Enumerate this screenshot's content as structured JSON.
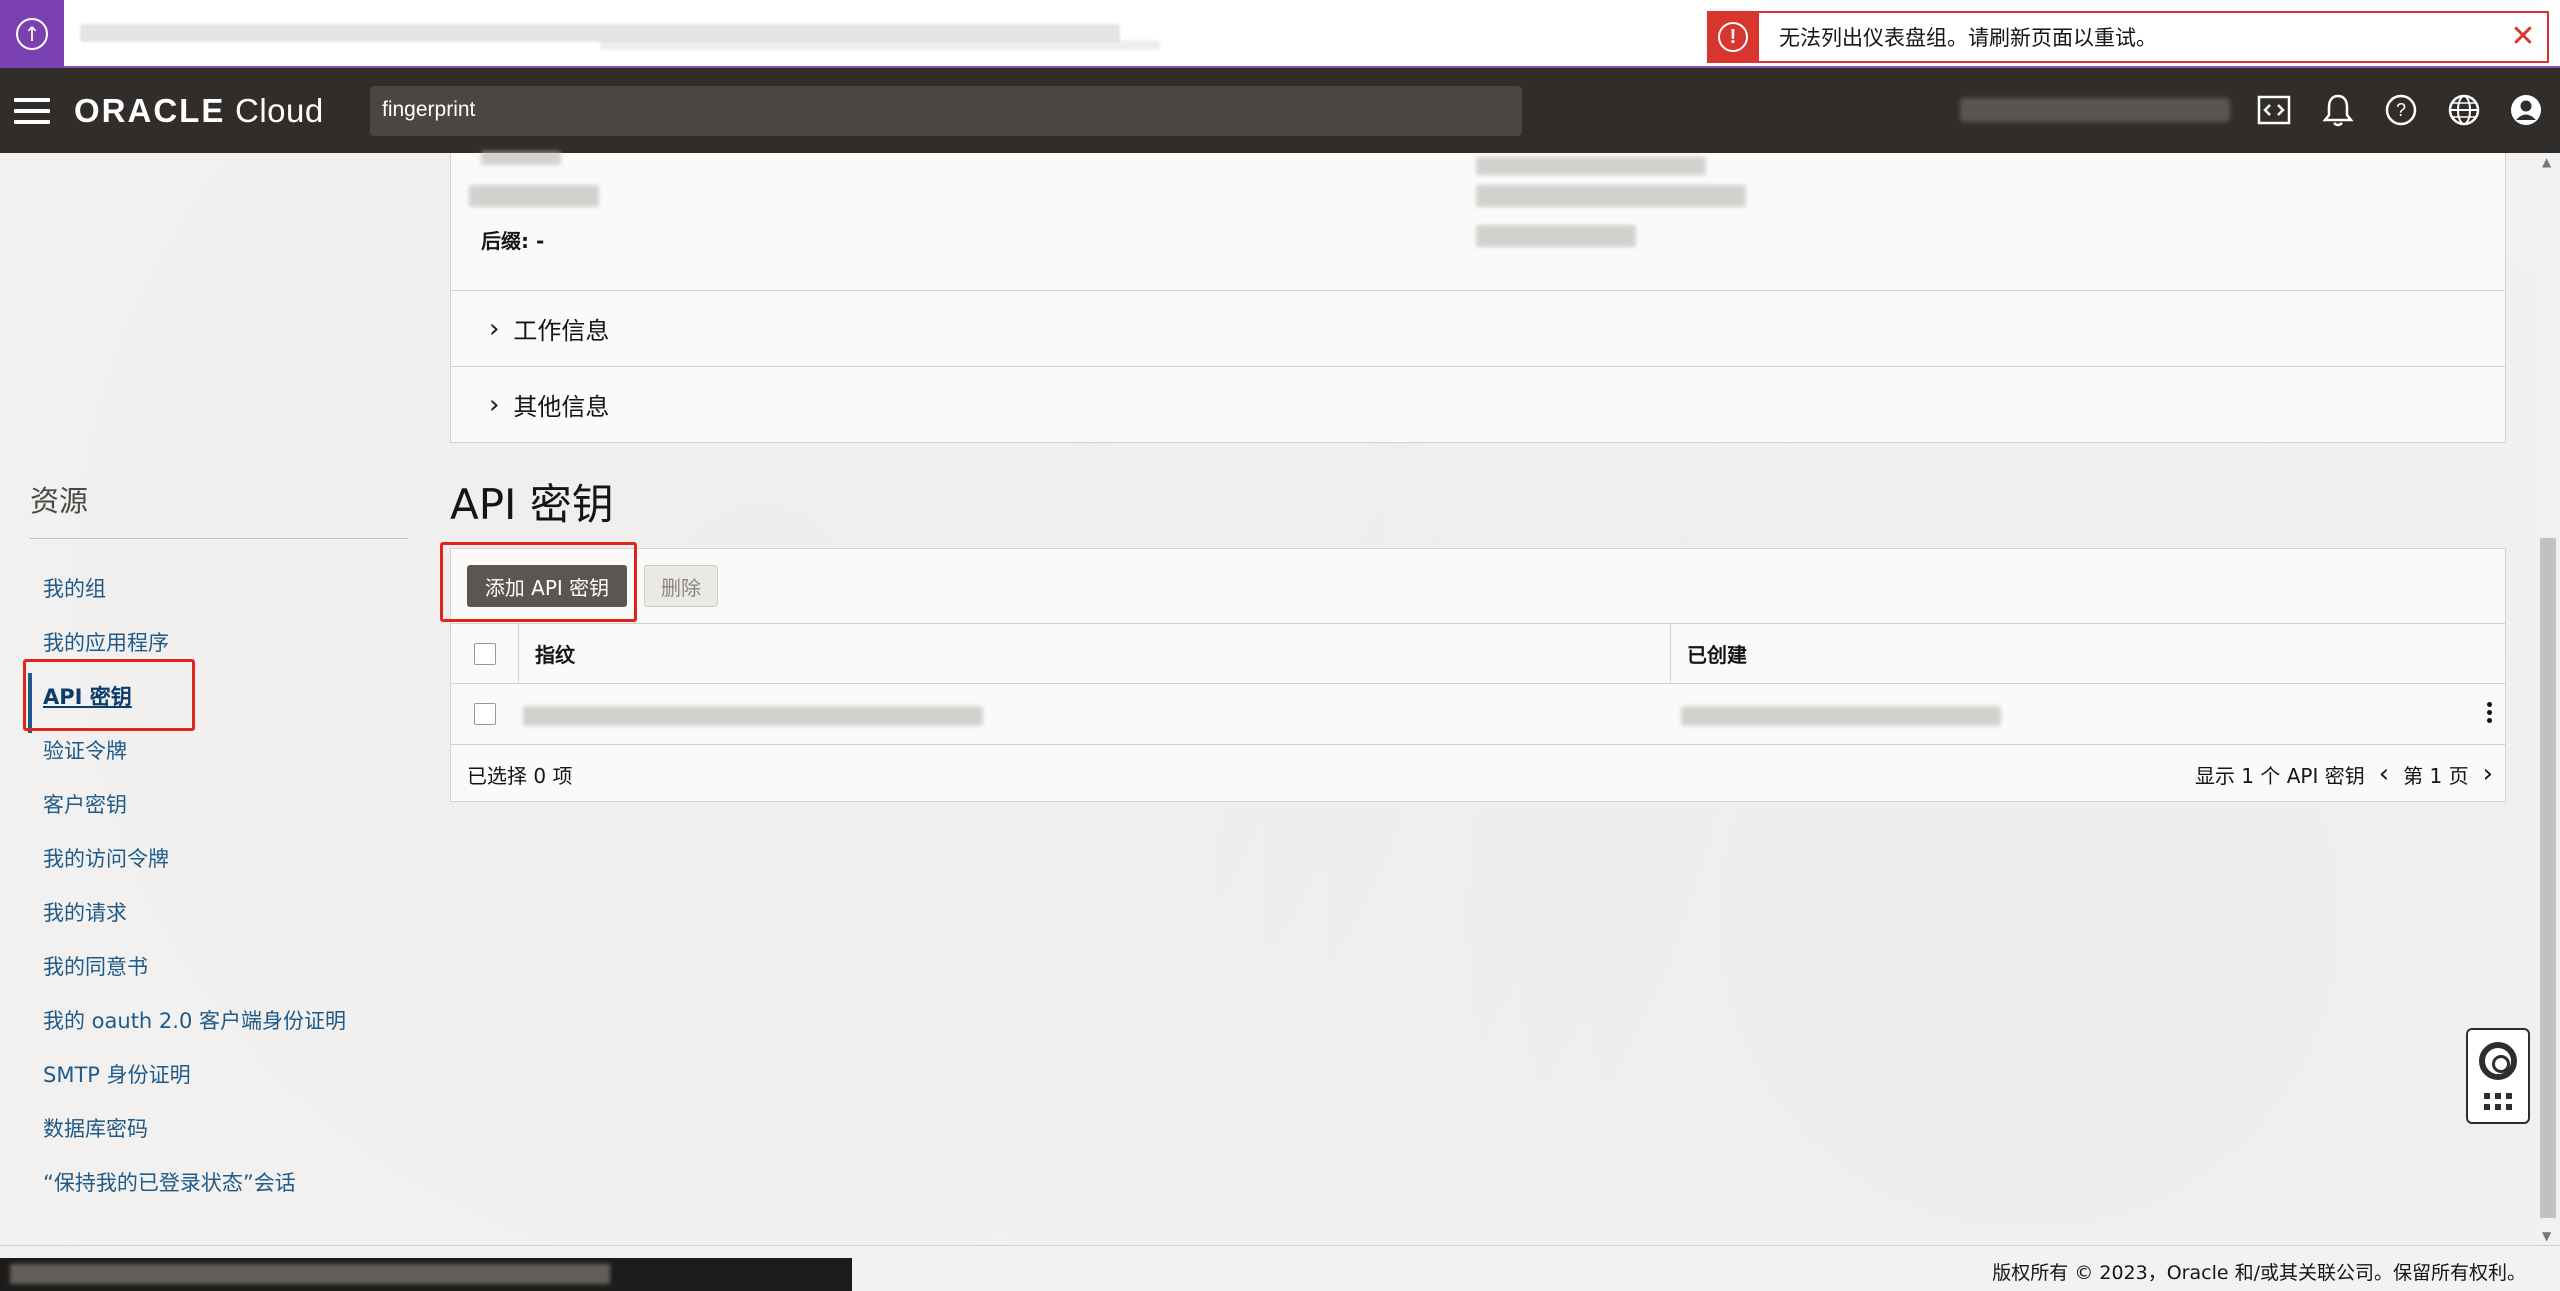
{
  "toast": {
    "message": "无法列出仪表盘组。请刷新页面以重试。",
    "type": "error"
  },
  "header": {
    "brand_bold": "ORACLE",
    "brand_light": "Cloud",
    "search_value": "fingerprint",
    "icons": [
      "code-editor-icon",
      "bell-icon",
      "help-icon",
      "globe-icon",
      "user-icon"
    ]
  },
  "details": {
    "suffix_label": "后缀: -",
    "sections": [
      {
        "label": "工作信息"
      },
      {
        "label": "其他信息"
      }
    ]
  },
  "resources": {
    "title": "资源",
    "items": [
      {
        "label": "我的组"
      },
      {
        "label": "我的应用程序"
      },
      {
        "label": "API 密钥"
      },
      {
        "label": "验证令牌"
      },
      {
        "label": "客户密钥"
      },
      {
        "label": "我的访问令牌"
      },
      {
        "label": "我的请求"
      },
      {
        "label": "我的同意书"
      },
      {
        "label": "我的 oauth 2.0 客户端身份证明"
      },
      {
        "label": "SMTP 身份证明"
      },
      {
        "label": "数据库密码"
      },
      {
        "label": "“保持我的已登录状态”会话"
      }
    ],
    "active_index": 2
  },
  "api_keys": {
    "title": "API 密钥",
    "add_button": "添加 API 密钥",
    "delete_button": "删除",
    "columns": [
      "指纹",
      "已创建"
    ],
    "selected_text": "已选择 0 项",
    "showing_text": "显示 1 个 API 密钥",
    "page_text": "第 1 页"
  },
  "footer": {
    "copyright": "版权所有 © 2023，Oracle 和/或其关联公司。保留所有权利。"
  },
  "colors": {
    "header_bg": "#312d2a",
    "error": "#d9352f",
    "link": "#1e5a8a",
    "highlight_box": "#e0241b"
  }
}
